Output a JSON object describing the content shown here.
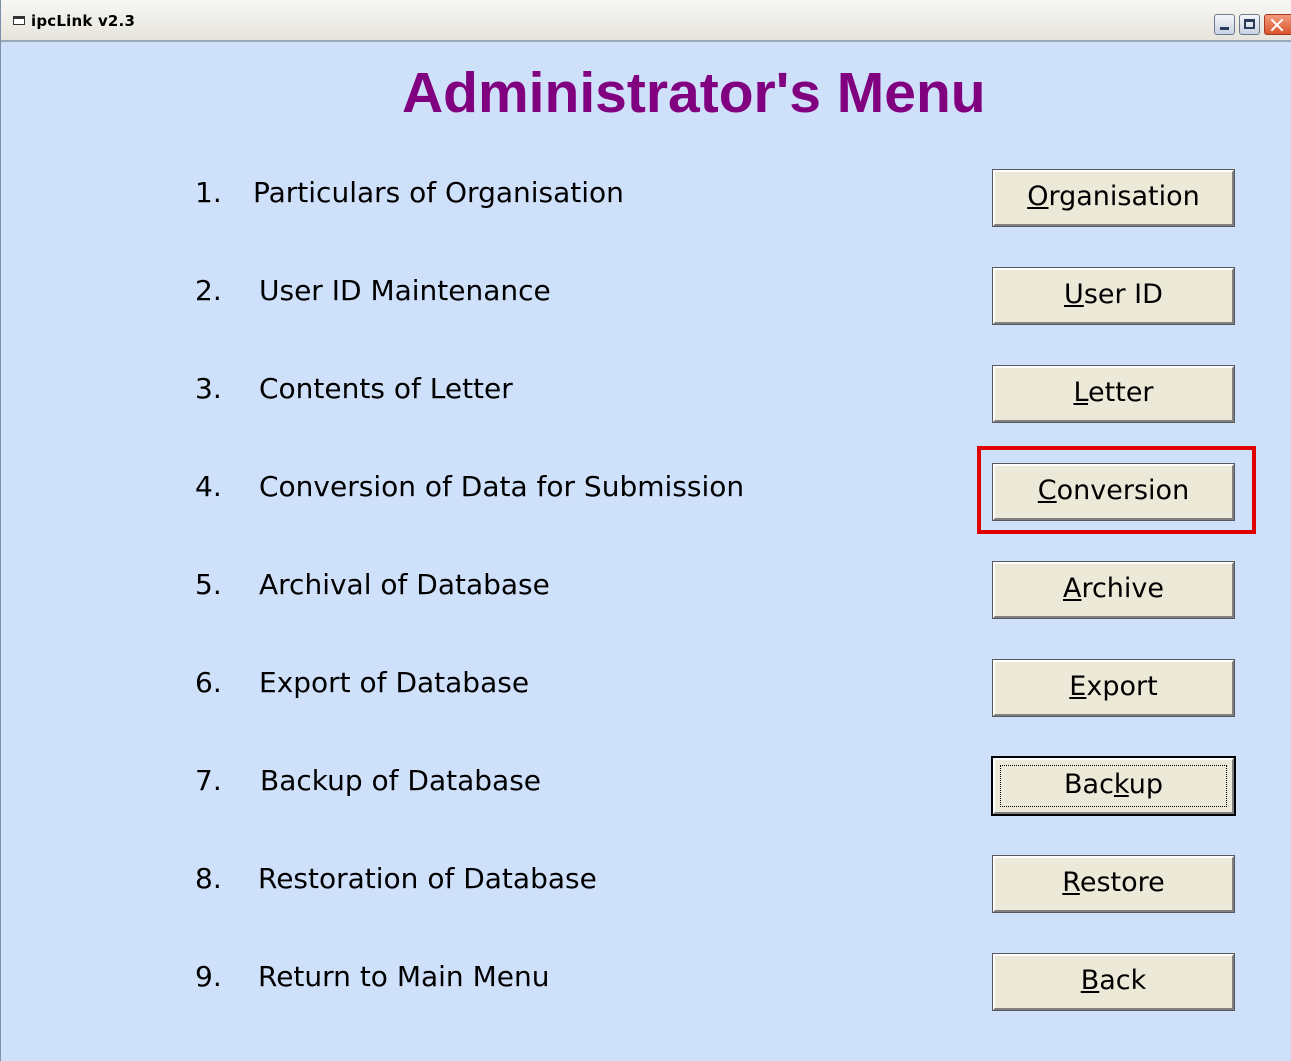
{
  "window": {
    "title": "ipcLink v2.3"
  },
  "heading": "Administrator's Menu",
  "colors": {
    "background": "#cfe0fb",
    "heading": "#800080",
    "highlight": "#e00000",
    "button_face": "#ece9d8"
  },
  "menu": {
    "items": [
      {
        "number": "1.",
        "label": "Particulars of Organisation",
        "button": {
          "pre": "",
          "accel": "O",
          "post": "rganisation"
        }
      },
      {
        "number": "2.",
        "label": "User ID Maintenance",
        "button": {
          "pre": "",
          "accel": "U",
          "post": "ser ID"
        }
      },
      {
        "number": "3.",
        "label": "Contents of Letter",
        "button": {
          "pre": "",
          "accel": "L",
          "post": "etter"
        }
      },
      {
        "number": "4.",
        "label": "Conversion of Data for Submission",
        "button": {
          "pre": "",
          "accel": "C",
          "post": "onversion"
        }
      },
      {
        "number": "5.",
        "label": "Archival of Database",
        "button": {
          "pre": "",
          "accel": "A",
          "post": "rchive"
        }
      },
      {
        "number": "6.",
        "label": "Export of Database",
        "button": {
          "pre": "",
          "accel": "E",
          "post": "xport"
        }
      },
      {
        "number": "7.",
        "label": "Backup of Database",
        "button": {
          "pre": "Bac",
          "accel": "k",
          "post": "up"
        }
      },
      {
        "number": "8.",
        "label": "Restoration of Database",
        "button": {
          "pre": "",
          "accel": "R",
          "post": "estore"
        }
      },
      {
        "number": "9.",
        "label": "Return to Main Menu",
        "button": {
          "pre": "",
          "accel": "B",
          "post": "ack"
        }
      }
    ]
  }
}
